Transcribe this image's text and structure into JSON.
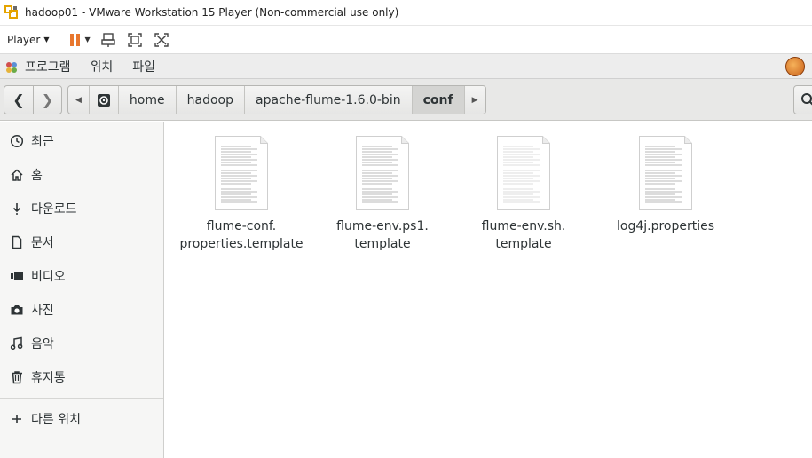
{
  "window": {
    "title": "hadoop01 - VMware Workstation 15 Player (Non-commercial use only)"
  },
  "vmware_toolbar": {
    "player_label": "Player"
  },
  "gnome_bar": {
    "menus": [
      "프로그램",
      "위치",
      "파일"
    ]
  },
  "pathbar": {
    "segments": [
      "home",
      "hadoop",
      "apache-flume-1.6.0-bin",
      "conf"
    ],
    "active": "conf"
  },
  "sidebar": {
    "items": [
      {
        "label": "최근",
        "icon": "clock-icon"
      },
      {
        "label": "홈",
        "icon": "home-icon"
      },
      {
        "label": "다운로드",
        "icon": "download-icon"
      },
      {
        "label": "문서",
        "icon": "document-icon"
      },
      {
        "label": "비디오",
        "icon": "video-icon"
      },
      {
        "label": "사진",
        "icon": "camera-icon"
      },
      {
        "label": "음악",
        "icon": "music-icon"
      },
      {
        "label": "휴지통",
        "icon": "trash-icon"
      }
    ],
    "other_locations": {
      "label": "다른 위치",
      "icon": "plus-icon"
    }
  },
  "files": [
    {
      "line1": "flume-conf.",
      "line2": "properties.template",
      "icon": "text-file-icon"
    },
    {
      "line1": "flume-env.ps1.",
      "line2": "template",
      "icon": "text-file-icon"
    },
    {
      "line1": "flume-env.sh.",
      "line2": "template",
      "icon": "text-file-icon"
    },
    {
      "line1": "log4j.properties",
      "line2": "",
      "icon": "text-file-icon"
    }
  ],
  "colors": {
    "accent_pause": "#e8772e",
    "sidebar_bg": "#f6f6f5",
    "header_bg": "#e8e8e7"
  }
}
